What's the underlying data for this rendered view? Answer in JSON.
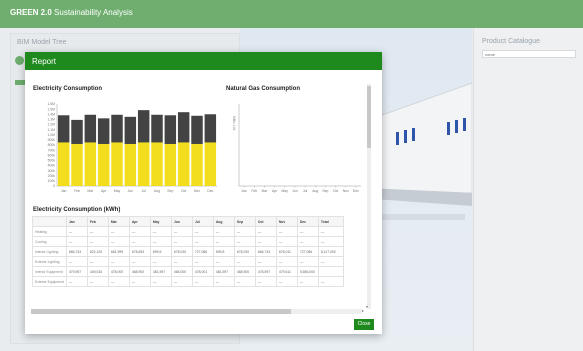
{
  "header": {
    "brand": "GREEN 2.0",
    "subtitle": "Sustainability Analysis"
  },
  "left_panel": {
    "title": "BIM Model Tree"
  },
  "right_panel": {
    "title": "Product Catalogue",
    "search_placeholder": "name"
  },
  "modal": {
    "title": "Report",
    "close_label": "Close"
  },
  "charts": {
    "electricity": {
      "title": "Electricity Consumption"
    },
    "gas": {
      "title": "Natural Gas Consumption",
      "ylabel": "MBtu 10k"
    }
  },
  "table": {
    "title": "Electricity Consumption (kWh)",
    "columns": [
      "",
      "Jan",
      "Feb",
      "Mar",
      "Apr",
      "May",
      "Jun",
      "Jul",
      "Aug",
      "Sep",
      "Oct",
      "Nov",
      "Dec",
      "Total"
    ],
    "rows": [
      [
        "Heating",
        "—",
        "—",
        "—",
        "—",
        "—",
        "—",
        "—",
        "—",
        "—",
        "—",
        "—",
        "—",
        "—"
      ],
      [
        "Cooling",
        "—",
        "—",
        "—",
        "—",
        "—",
        "—",
        "—",
        "—",
        "—",
        "—",
        "—",
        "—",
        "—"
      ],
      [
        "Interior Lighting",
        "666,743",
        "622,120",
        "681,999",
        "578,693",
        "699,6",
        "678,020",
        "727,086",
        "699,8",
        "678,020",
        "666,743",
        "678,011",
        "727,086",
        "8,117,000"
      ],
      [
        "Exterior Lighting",
        "—",
        "—",
        "—",
        "—",
        "—",
        "—",
        "—",
        "—",
        "—",
        "—",
        "—",
        "—",
        "—"
      ],
      [
        "Interior Equipment",
        "479,597",
        "449,034",
        "478,000",
        "468,900",
        "481,597",
        "468,000",
        "478,001",
        "481,597",
        "468,900",
        "478,597",
        "479,611",
        "5,656,000",
        ""
      ],
      [
        "Exterior Equipment",
        "—",
        "—",
        "—",
        "—",
        "—",
        "—",
        "—",
        "—",
        "—",
        "—",
        "—",
        "—",
        "—"
      ]
    ]
  },
  "chart_data": [
    {
      "type": "bar",
      "title": "Electricity Consumption",
      "categories": [
        "Jan",
        "Feb",
        "Mar",
        "Apr",
        "May",
        "Jun",
        "Jul",
        "Aug",
        "Sep",
        "Oct",
        "Nov",
        "Dec"
      ],
      "yticks": [
        "1.6M",
        "1.5M",
        "1.4M",
        "1.3M",
        "1.2M",
        "1.1M",
        "1.0M",
        "900k",
        "800k",
        "700k",
        "600k",
        "500k",
        "400k",
        "300k",
        "200k",
        "100k",
        "0"
      ],
      "ylim": [
        0,
        1600000
      ],
      "series": [
        {
          "values": [
            850000,
            820000,
            850000,
            820000,
            850000,
            820000,
            850000,
            850000,
            820000,
            850000,
            820000,
            850000
          ],
          "color": "#f2dd1f"
        },
        {
          "values": [
            530000,
            470000,
            540000,
            500000,
            540000,
            530000,
            630000,
            540000,
            560000,
            590000,
            550000,
            550000
          ],
          "color": "#434343"
        }
      ]
    },
    {
      "type": "bar",
      "title": "Natural Gas Consumption",
      "ylabel": "MBtu 10k",
      "categories": [
        "Jan",
        "Feb",
        "Mar",
        "Apr",
        "May",
        "Jun",
        "Jul",
        "Aug",
        "Sep",
        "Oct",
        "Nov",
        "Dec"
      ],
      "series": [
        {
          "values": [
            0,
            0,
            0,
            0,
            0,
            0,
            0,
            0,
            0,
            0,
            0,
            0
          ]
        }
      ]
    }
  ]
}
